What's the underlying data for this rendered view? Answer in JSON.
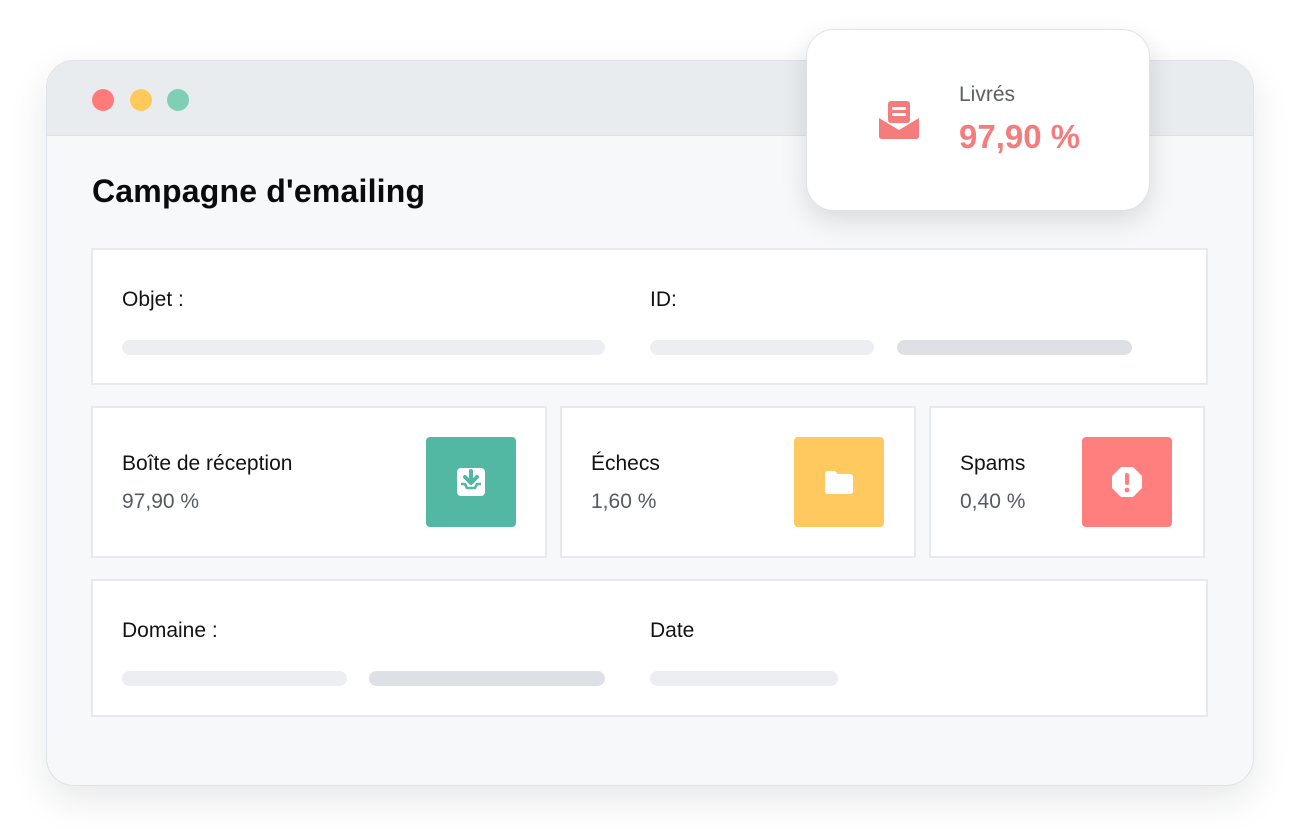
{
  "page": {
    "title": "Campagne d'emailing"
  },
  "info_top": {
    "subject_label": "Objet :",
    "id_label": "ID:"
  },
  "stats": [
    {
      "label": "Boîte de réception",
      "value": "97,90 %",
      "icon": "inbox-download-icon",
      "color": "#52b8a3"
    },
    {
      "label": "Échecs",
      "value": "1,60 %",
      "icon": "folder-icon",
      "color": "#ffc95f"
    },
    {
      "label": "Spams",
      "value": "0,40 %",
      "icon": "alert-octagon-icon",
      "color": "#ff7f7f"
    }
  ],
  "info_bottom": {
    "domain_label": "Domaine :",
    "date_label": "Date"
  },
  "delivered_popup": {
    "label": "Livrés",
    "value": "97,90 %",
    "icon": "open-envelope-icon",
    "color": "#f47c7c"
  },
  "window_controls": {
    "close_color": "#ff7b7b",
    "minimize_color": "#ffc95c",
    "maximize_color": "#7ecfb4"
  }
}
